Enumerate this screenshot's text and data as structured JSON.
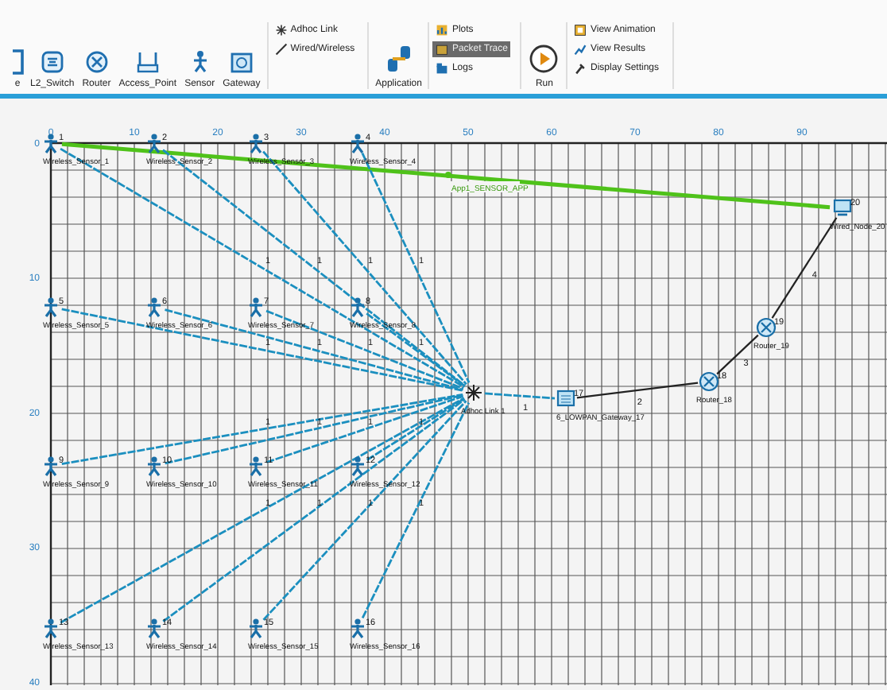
{
  "toolbar": {
    "device_buttons": [
      {
        "label": "e",
        "kind": "node"
      },
      {
        "label": "L2_Switch",
        "kind": "switch"
      },
      {
        "label": "Router",
        "kind": "router"
      },
      {
        "label": "Access_Point",
        "kind": "access_point"
      },
      {
        "label": "Sensor",
        "kind": "sensor"
      },
      {
        "label": "Gateway",
        "kind": "gateway"
      }
    ],
    "link_buttons": [
      {
        "label": "Adhoc Link",
        "kind": "adhoc"
      },
      {
        "label": "Wired/Wireless",
        "kind": "wired"
      }
    ],
    "application_button": {
      "label": "Application"
    },
    "output_buttons": [
      {
        "label": "Plots",
        "kind": "plots",
        "selected": false
      },
      {
        "label": "Packet Trace",
        "kind": "trace",
        "selected": true
      },
      {
        "label": "Logs",
        "kind": "logs",
        "selected": false
      }
    ],
    "run_button": {
      "label": "Run"
    },
    "view_buttons": [
      {
        "label": "View Animation",
        "kind": "animation"
      },
      {
        "label": "View Results",
        "kind": "results"
      },
      {
        "label": "Display Settings",
        "kind": "settings"
      }
    ]
  },
  "canvas": {
    "x_ruler": [
      "0",
      "10",
      "20",
      "30",
      "40",
      "50",
      "60",
      "70",
      "80",
      "90"
    ],
    "y_ruler": [
      "0",
      "10",
      "20",
      "30",
      "40"
    ],
    "nodes": [
      {
        "kind": "sensor",
        "id": "1",
        "name": "Wireless_Sensor_1"
      },
      {
        "kind": "sensor",
        "id": "2",
        "name": "Wireless_Sensor_2"
      },
      {
        "kind": "sensor",
        "id": "3",
        "name": "Wireless_Sensor_3"
      },
      {
        "kind": "sensor",
        "id": "4",
        "name": "Wireless_Sensor_4"
      },
      {
        "kind": "sensor",
        "id": "5",
        "name": "Wireless_Sensor_5"
      },
      {
        "kind": "sensor",
        "id": "6",
        "name": "Wireless_Sensor_6"
      },
      {
        "kind": "sensor",
        "id": "7",
        "name": "Wireless_Sensor_7"
      },
      {
        "kind": "sensor",
        "id": "8",
        "name": "Wireless_Sensor_8"
      },
      {
        "kind": "sensor",
        "id": "9",
        "name": "Wireless_Sensor_9"
      },
      {
        "kind": "sensor",
        "id": "10",
        "name": "Wireless_Sensor_10"
      },
      {
        "kind": "sensor",
        "id": "11",
        "name": "Wireless_Sensor_11"
      },
      {
        "kind": "sensor",
        "id": "12",
        "name": "Wireless_Sensor_12"
      },
      {
        "kind": "sensor",
        "id": "13",
        "name": "Wireless_Sensor_13"
      },
      {
        "kind": "sensor",
        "id": "14",
        "name": "Wireless_Sensor_14"
      },
      {
        "kind": "sensor",
        "id": "15",
        "name": "Wireless_Sensor_15"
      },
      {
        "kind": "sensor",
        "id": "16",
        "name": "Wireless_Sensor_16"
      },
      {
        "kind": "adhoc",
        "name": "Adhoc Link 1"
      },
      {
        "kind": "gateway",
        "id": "17",
        "name": "6_LOWPAN_Gateway_17"
      },
      {
        "kind": "router",
        "id": "18",
        "name": "Router_18"
      },
      {
        "kind": "router",
        "id": "19",
        "name": "Router_19"
      },
      {
        "kind": "wired_node",
        "id": "20",
        "name": "Wired_Node_20"
      }
    ],
    "links": [
      {
        "kind": "wireless",
        "label": "1"
      },
      {
        "kind": "wireless",
        "label": "1"
      },
      {
        "kind": "wireless",
        "label": "1"
      },
      {
        "kind": "wireless",
        "label": "1"
      },
      {
        "kind": "wireless",
        "label": "1"
      },
      {
        "kind": "wireless",
        "label": "1"
      },
      {
        "kind": "wireless",
        "label": "1"
      },
      {
        "kind": "wireless",
        "label": "1"
      },
      {
        "kind": "wireless",
        "label": "1"
      },
      {
        "kind": "wireless",
        "label": "1"
      },
      {
        "kind": "wireless",
        "label": "1"
      },
      {
        "kind": "wireless",
        "label": "1"
      },
      {
        "kind": "wireless",
        "label": "1"
      },
      {
        "kind": "wireless",
        "label": "1"
      },
      {
        "kind": "wireless",
        "label": "1"
      },
      {
        "kind": "wireless",
        "label": "1"
      },
      {
        "kind": "wireless",
        "label": "1"
      },
      {
        "kind": "wired",
        "label": "2"
      },
      {
        "kind": "wired",
        "label": "3"
      },
      {
        "kind": "wired",
        "label": "4"
      }
    ],
    "application": {
      "label": "App1_SENSOR_APP"
    }
  }
}
